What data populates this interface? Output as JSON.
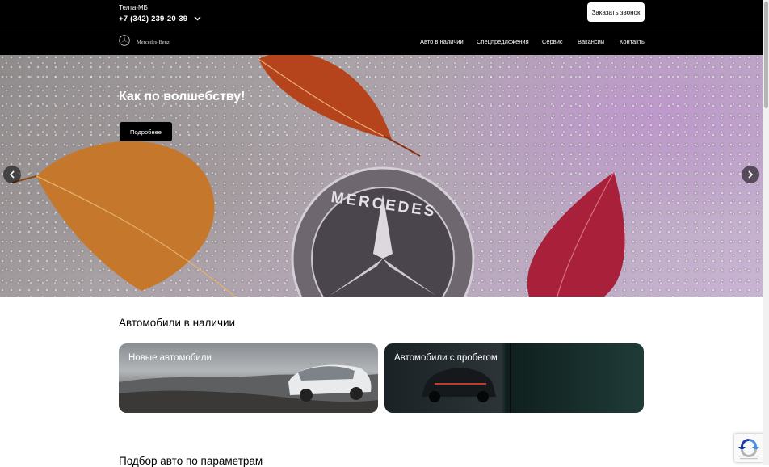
{
  "header": {
    "dealer_name": "Телта-МБ",
    "phone": "+7 (342) 239-20-39",
    "callback_label": "Заказать звонок"
  },
  "nav": {
    "logo_text": "Mercedes-Benz",
    "items": [
      {
        "label": "Авто в наличии"
      },
      {
        "label": "Спецпредложения"
      },
      {
        "label": "Сервис"
      },
      {
        "label": "Вакансии"
      },
      {
        "label": "Контакты"
      }
    ]
  },
  "hero": {
    "title": "Как по волшебству!",
    "button_label": "Подробнее",
    "emblem_text": "MERCEDES"
  },
  "stock": {
    "title": "Автомобили в наличии",
    "cards": [
      {
        "label": "Новые автомобили"
      },
      {
        "label": "Автомобили с пробегом"
      }
    ]
  },
  "filter": {
    "title": "Подбор авто по параметрам"
  }
}
